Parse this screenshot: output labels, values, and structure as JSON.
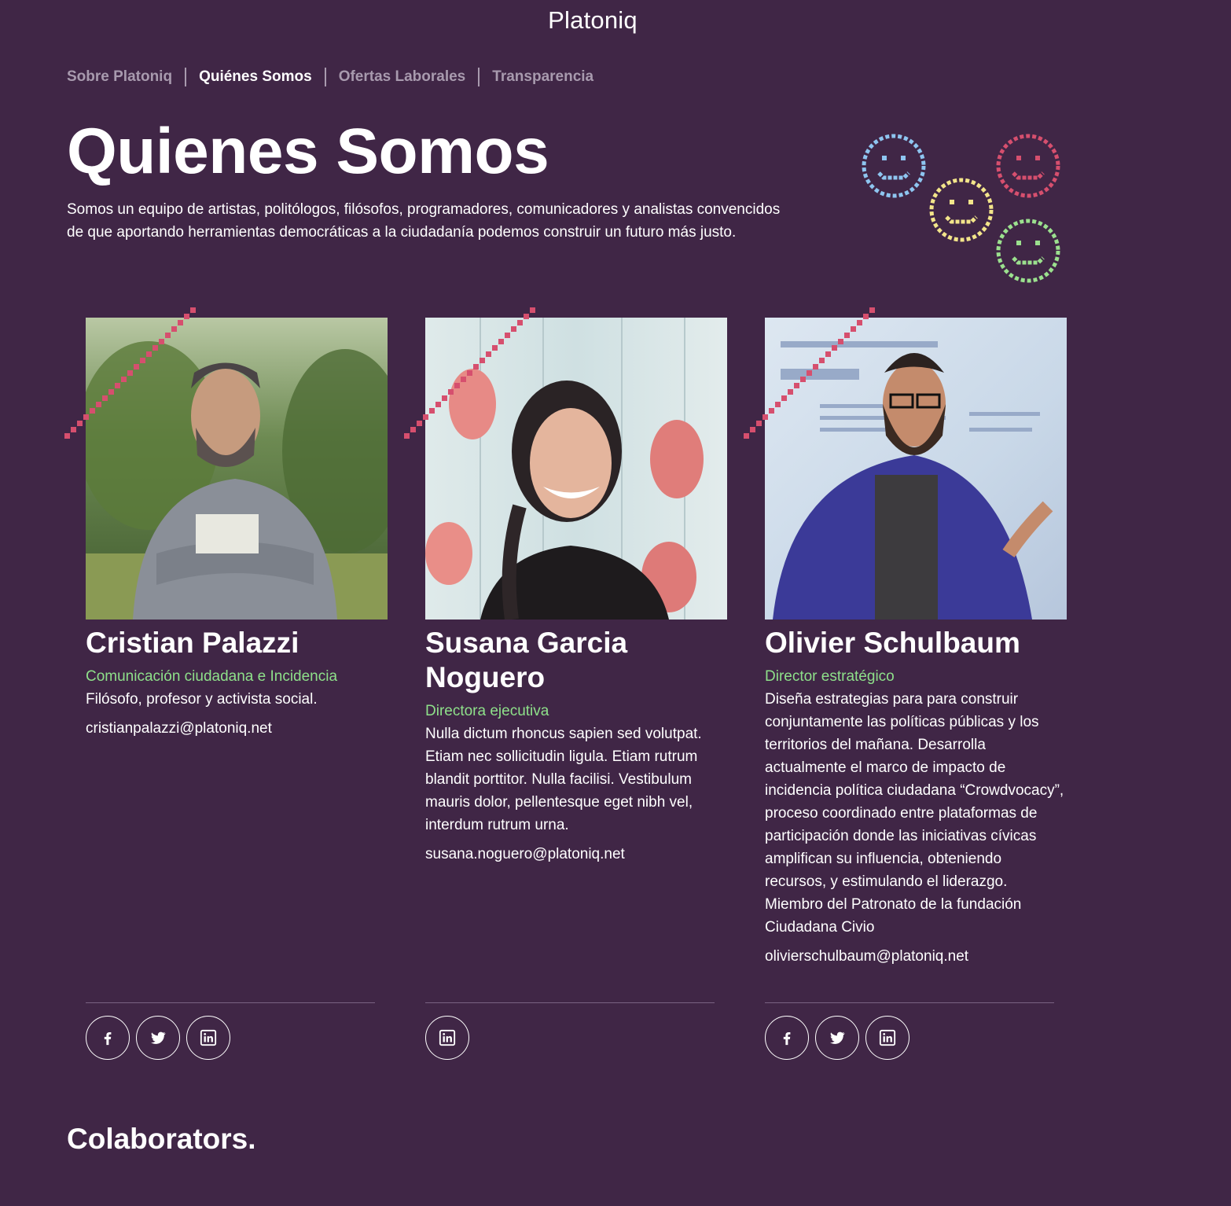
{
  "site": {
    "title": "Platoniq"
  },
  "subnav": {
    "items": [
      {
        "label": "Sobre Platoniq"
      },
      {
        "label": "Quiénes Somos"
      },
      {
        "label": "Ofertas Laborales"
      },
      {
        "label": "Transparencia"
      }
    ],
    "active": "Quiénes Somos"
  },
  "hero": {
    "title": "Quienes Somos",
    "intro_line1": "Somos un equipo de artistas, politólogos, filósofos, programadores, comunicadores y analistas convencidos",
    "intro_line2": "de que aportando herramientas democráticas a la ciudadanía podemos construir un futuro más justo."
  },
  "team": [
    {
      "name": "Cristian Palazzi",
      "role": "Comunicación ciudadana e Incidencia",
      "bio": "Filósofo, profesor y activista social.",
      "email": "cristianpalazzi@platoniq.net",
      "socials": [
        "facebook",
        "twitter",
        "linkedin"
      ]
    },
    {
      "name": "Susana Garcia Noguero",
      "role": "Directora ejecutiva",
      "bio": "Nulla dictum rhoncus sapien sed volutpat. Etiam nec sollicitudin ligula. Etiam rutrum blandit porttitor. Nulla facilisi. Vestibulum mauris dolor, pellentesque eget nibh vel, interdum rutrum urna.",
      "email": "susana.noguero@platoniq.net",
      "socials": [
        "linkedin"
      ]
    },
    {
      "name": "Olivier Schulbaum",
      "role": "Director estratégico",
      "bio": "Diseña estrategias para para construir conjuntamente las políticas públicas y los territorios del mañana. Desarrolla actualmente el marco de impacto de incidencia política ciudadana “Crowdvocacy”, proceso coordinado entre plataformas de participación donde las iniciativas cívicas amplifican su influencia, obteniendo recursos, y estimulando el liderazgo. Miembro del Patronato de la fundación Ciudadana Civio",
      "email": "olivierschulbaum@platoniq.net",
      "socials": [
        "facebook",
        "twitter",
        "linkedin"
      ]
    }
  ],
  "colaborators": {
    "title": "Colaborators."
  },
  "colors": {
    "background": "#402646",
    "accent_green": "#8ee08a",
    "deco_red": "#d64f6e",
    "smiley_blue": "#8ec5f0",
    "smiley_yellow": "#f3e58a",
    "smiley_red": "#d64f6e",
    "smiley_green": "#9be08e"
  }
}
